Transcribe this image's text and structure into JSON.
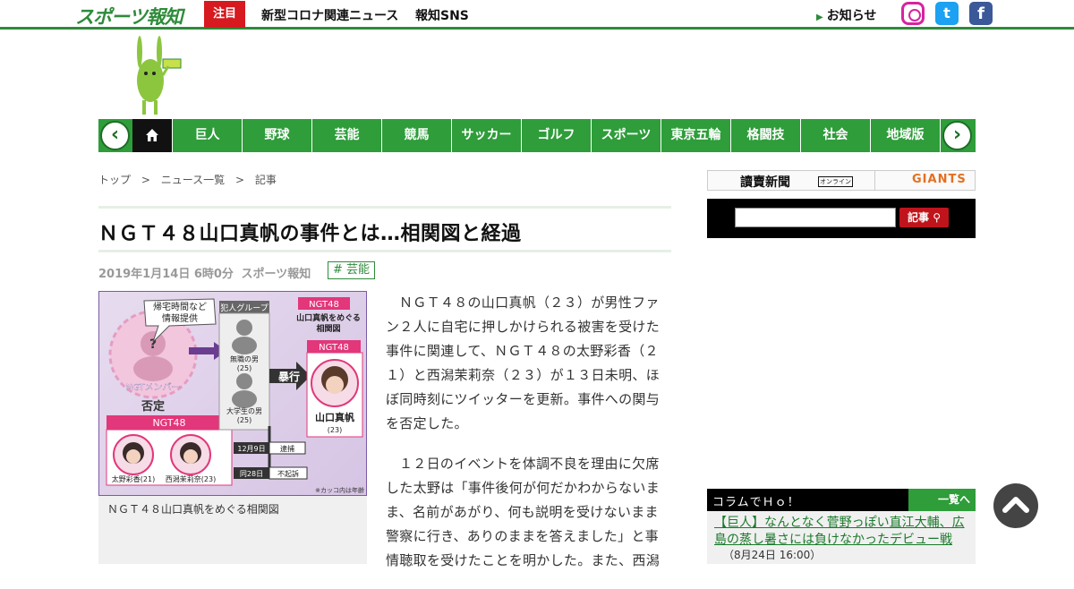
{
  "header": {
    "logo_text": "スポーツ報知",
    "notice_tag": "注目",
    "links": [
      "新型コロナ関連ニュース",
      "報知SNS"
    ],
    "oshirase": "お知らせ",
    "sns": [
      "instagram-icon",
      "twitter-icon",
      "facebook-icon"
    ]
  },
  "nav": {
    "items": [
      "巨人",
      "野球",
      "芸能",
      "競馬",
      "サッカー",
      "ゴルフ",
      "スポーツ",
      "東京五輪",
      "格闘技",
      "社会",
      "地域版"
    ]
  },
  "breadcrumb": {
    "items": [
      "トップ",
      ">",
      "ニュース一覧",
      ">",
      "記事"
    ]
  },
  "article": {
    "title": "ＮＧＴ４８山口真帆の事件とは…相関図と経過",
    "date": "2019年1月14日 6時0分",
    "source": "スポーツ報知",
    "category": "# 芸能",
    "image_caption": "ＮＧＴ４８山口真帆をめぐる相関図",
    "paragraphs": [
      "ＮＧＴ４８の山口真帆（２３）が男性ファン２人に自宅に押しかけられる被害を受けた事件に関連して、ＮＧＴ４８の太野彩香（２１）と西潟茉莉奈（２３）が１３日未明、ほぼ同時刻にツイッターを更新。事件への関与を否定した。",
      "１２日のイベントを体調不良を理由に欠席した太野は「事件後何が何だかわからないまま、名前があがり、何も説明を受けないまま警察に行き、ありのままを答えました」と事情聴取を受けたことを明かした。また、西潟"
    ]
  },
  "figure": {
    "labels": {
      "ngt48_top": "NGT48",
      "title": "山口真帆をめぐる\n相関図",
      "info": "帰宅時間など\n情報提供",
      "member": "NGTメンバー",
      "deny": "否定",
      "ngt48_left": "NGT48",
      "group": "犯人グループ",
      "man1": "無職の男\n(25)",
      "man2": "大学生の男\n(25)",
      "assault": "暴行",
      "ngt48_right": "NGT48",
      "yamaguchi": "山口真帆",
      "yamaguchi_age": "(23)",
      "ota": "太野彩香(21)",
      "nishigata": "西潟茉莉奈(23)",
      "arrest_date": "12月9日",
      "arrest": "逮捕",
      "release_date": "同28日",
      "release": "不起訴",
      "note": "※カッコ内は年齢"
    }
  },
  "sidebar": {
    "yomiuri": "讀賣新聞",
    "yomiuri_online": "オンライン",
    "giants": "GIANTS",
    "search_button": "記事",
    "column_title": "コラムでＨｏ！",
    "column_more": "一覧へ",
    "column_link": "【巨人】なんとなく菅野っぽい直江大輔、広島の蒸し暑さには負けなかったデビュー戦",
    "column_date": "（8月24日 16:00）"
  },
  "colors": {
    "brand_green": "#2e8b3a",
    "nav_green": "#2e9d3a",
    "notice_red": "#d71920"
  }
}
